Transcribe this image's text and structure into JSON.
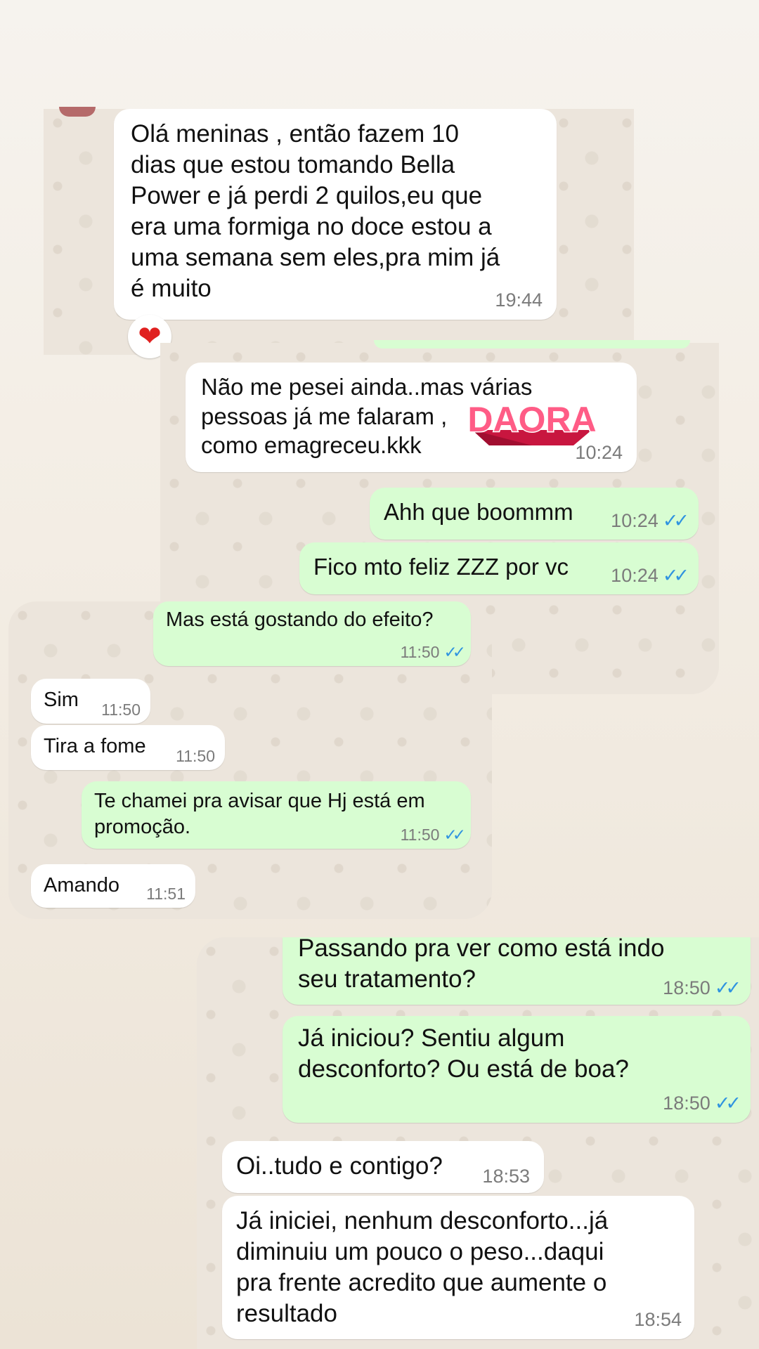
{
  "messages": [
    {
      "text": "Olá meninas , então fazem 10\ndias que estou tomando Bella\nPower e já perdi 2 quilos,eu que\nera uma formiga no doce estou a\numa semana sem eles,pra mim já\né muito",
      "time": "19:44"
    },
    {
      "text": "Não me pesei ainda..mas várias\npessoas já me falaram ,\ncomo emagreceu.kkk",
      "time": "10:24"
    },
    {
      "text": "Ahh que boommm",
      "time": "10:24"
    },
    {
      "text": "Fico mto feliz ZZZ por vc",
      "time": "10:24"
    },
    {
      "text": "Mas está gostando do efeito?",
      "time": "11:50"
    },
    {
      "text": "Sim",
      "time": "11:50"
    },
    {
      "text": "Tira a fome",
      "time": "11:50"
    },
    {
      "text": "Te chamei pra avisar que Hj está em\npromoção.",
      "time": "11:50"
    },
    {
      "text": "Amando",
      "time": "11:51"
    },
    {
      "text": "Passando pra ver como está indo\nseu tratamento?",
      "time": "18:50"
    },
    {
      "text": "Já iniciou? Sentiu algum\ndesconforto? Ou está de boa?",
      "time": "18:50"
    },
    {
      "text": "Oi..tudo e contigo?",
      "time": "18:53"
    },
    {
      "text": "Já iniciei, nenhum desconforto...já\ndiminuiu um pouco o peso...daqui\npra frente acredito que aumente o\nresultado",
      "time": "18:54"
    }
  ],
  "sticker": {
    "text": "DAORA"
  },
  "reaction": {
    "icon": "heart-icon"
  },
  "colors": {
    "incoming": "#ffffff",
    "outgoing": "#d8fdd2",
    "ticks": "#2f93e0"
  }
}
